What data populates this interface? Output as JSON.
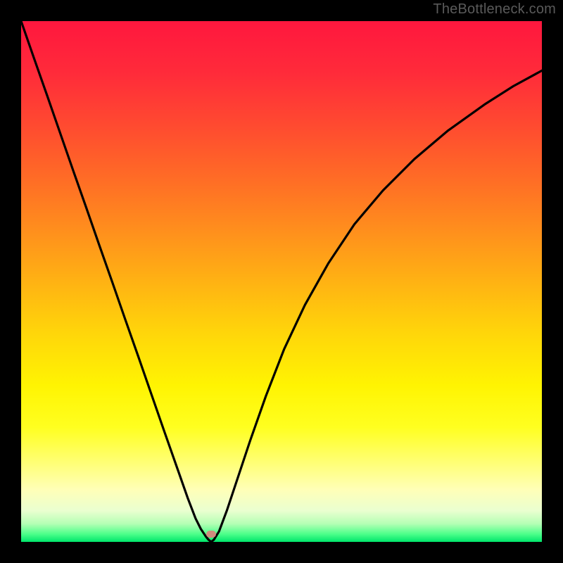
{
  "watermark": "TheBottleneck.com",
  "gradient": {
    "stops": [
      {
        "offset": 0.0,
        "color": "#ff173e"
      },
      {
        "offset": 0.1,
        "color": "#ff2b3a"
      },
      {
        "offset": 0.2,
        "color": "#ff4a30"
      },
      {
        "offset": 0.3,
        "color": "#ff6b26"
      },
      {
        "offset": 0.4,
        "color": "#ff8e1d"
      },
      {
        "offset": 0.5,
        "color": "#ffb213"
      },
      {
        "offset": 0.6,
        "color": "#ffd60a"
      },
      {
        "offset": 0.7,
        "color": "#fff402"
      },
      {
        "offset": 0.78,
        "color": "#ffff20"
      },
      {
        "offset": 0.85,
        "color": "#ffff78"
      },
      {
        "offset": 0.9,
        "color": "#ffffb8"
      },
      {
        "offset": 0.94,
        "color": "#eaffd0"
      },
      {
        "offset": 0.965,
        "color": "#b5ffb5"
      },
      {
        "offset": 0.985,
        "color": "#4cff8a"
      },
      {
        "offset": 1.0,
        "color": "#00e56b"
      }
    ]
  },
  "curve_stroke": "#000000",
  "curve_stroke_width": 3.2,
  "marker": {
    "x_frac": 0.365,
    "y_frac": 0.985,
    "color": "#cf8c7e"
  },
  "chart_data": {
    "type": "line",
    "title": "",
    "xlabel": "",
    "ylabel": "",
    "xlim": [
      0,
      1
    ],
    "ylim": [
      0,
      1
    ],
    "series": [
      {
        "name": "bottleneck-curve",
        "x": [
          0.0,
          0.025,
          0.05,
          0.075,
          0.1,
          0.125,
          0.15,
          0.175,
          0.2,
          0.225,
          0.25,
          0.275,
          0.3,
          0.32,
          0.335,
          0.345,
          0.355,
          0.36,
          0.365,
          0.37,
          0.38,
          0.395,
          0.415,
          0.44,
          0.47,
          0.505,
          0.545,
          0.59,
          0.64,
          0.695,
          0.755,
          0.82,
          0.89,
          0.945,
          1.0
        ],
        "y": [
          1.0,
          0.928,
          0.857,
          0.785,
          0.713,
          0.642,
          0.57,
          0.499,
          0.427,
          0.356,
          0.284,
          0.212,
          0.141,
          0.084,
          0.045,
          0.025,
          0.01,
          0.004,
          0.0,
          0.004,
          0.02,
          0.06,
          0.12,
          0.195,
          0.28,
          0.37,
          0.455,
          0.535,
          0.61,
          0.675,
          0.735,
          0.79,
          0.84,
          0.875,
          0.905
        ]
      }
    ],
    "marker_point": {
      "x": 0.365,
      "y": 0.015
    },
    "background": "vertical-rainbow-gradient",
    "notes": "Axes are unlabeled; x and y expressed as fractions of plot width/height. y=1 is top of colored area, y=0 is bottom (green)."
  }
}
